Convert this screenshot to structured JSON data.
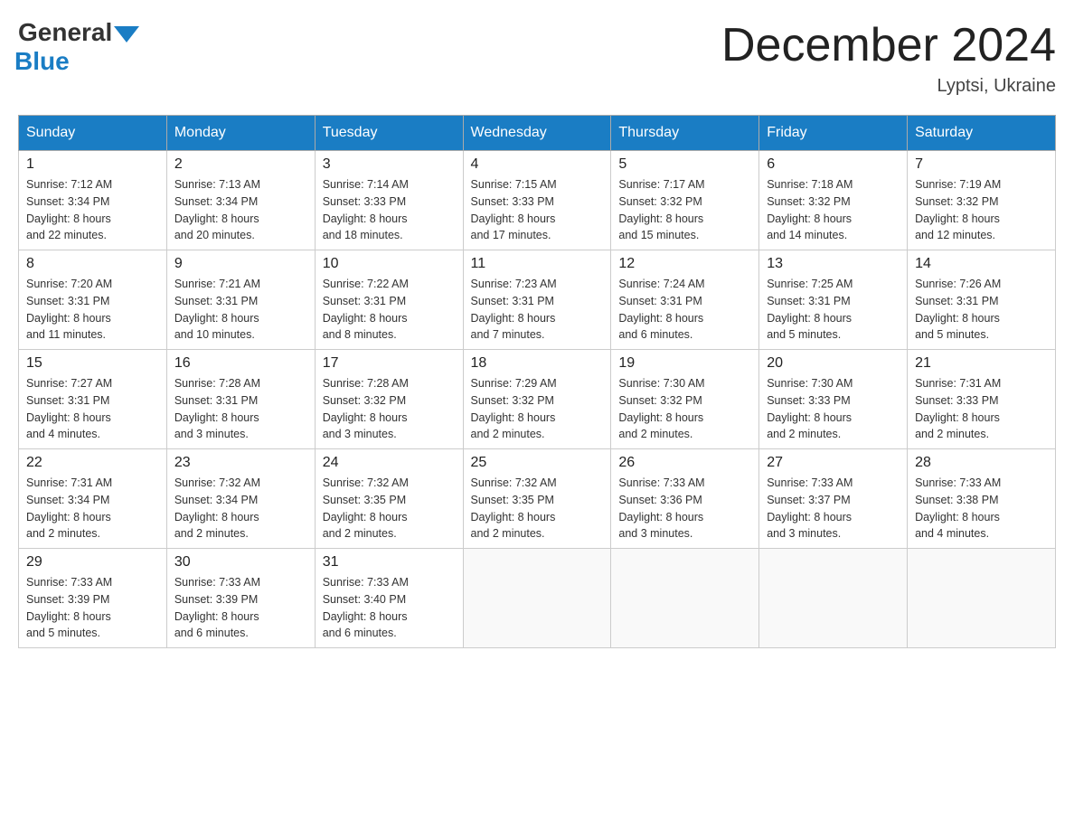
{
  "logo": {
    "general": "General",
    "blue": "Blue"
  },
  "header": {
    "month": "December 2024",
    "location": "Lyptsi, Ukraine"
  },
  "weekdays": [
    "Sunday",
    "Monday",
    "Tuesday",
    "Wednesday",
    "Thursday",
    "Friday",
    "Saturday"
  ],
  "weeks": [
    [
      {
        "day": "1",
        "sunrise": "7:12 AM",
        "sunset": "3:34 PM",
        "daylight": "8 hours and 22 minutes."
      },
      {
        "day": "2",
        "sunrise": "7:13 AM",
        "sunset": "3:34 PM",
        "daylight": "8 hours and 20 minutes."
      },
      {
        "day": "3",
        "sunrise": "7:14 AM",
        "sunset": "3:33 PM",
        "daylight": "8 hours and 18 minutes."
      },
      {
        "day": "4",
        "sunrise": "7:15 AM",
        "sunset": "3:33 PM",
        "daylight": "8 hours and 17 minutes."
      },
      {
        "day": "5",
        "sunrise": "7:17 AM",
        "sunset": "3:32 PM",
        "daylight": "8 hours and 15 minutes."
      },
      {
        "day": "6",
        "sunrise": "7:18 AM",
        "sunset": "3:32 PM",
        "daylight": "8 hours and 14 minutes."
      },
      {
        "day": "7",
        "sunrise": "7:19 AM",
        "sunset": "3:32 PM",
        "daylight": "8 hours and 12 minutes."
      }
    ],
    [
      {
        "day": "8",
        "sunrise": "7:20 AM",
        "sunset": "3:31 PM",
        "daylight": "8 hours and 11 minutes."
      },
      {
        "day": "9",
        "sunrise": "7:21 AM",
        "sunset": "3:31 PM",
        "daylight": "8 hours and 10 minutes."
      },
      {
        "day": "10",
        "sunrise": "7:22 AM",
        "sunset": "3:31 PM",
        "daylight": "8 hours and 8 minutes."
      },
      {
        "day": "11",
        "sunrise": "7:23 AM",
        "sunset": "3:31 PM",
        "daylight": "8 hours and 7 minutes."
      },
      {
        "day": "12",
        "sunrise": "7:24 AM",
        "sunset": "3:31 PM",
        "daylight": "8 hours and 6 minutes."
      },
      {
        "day": "13",
        "sunrise": "7:25 AM",
        "sunset": "3:31 PM",
        "daylight": "8 hours and 5 minutes."
      },
      {
        "day": "14",
        "sunrise": "7:26 AM",
        "sunset": "3:31 PM",
        "daylight": "8 hours and 5 minutes."
      }
    ],
    [
      {
        "day": "15",
        "sunrise": "7:27 AM",
        "sunset": "3:31 PM",
        "daylight": "8 hours and 4 minutes."
      },
      {
        "day": "16",
        "sunrise": "7:28 AM",
        "sunset": "3:31 PM",
        "daylight": "8 hours and 3 minutes."
      },
      {
        "day": "17",
        "sunrise": "7:28 AM",
        "sunset": "3:32 PM",
        "daylight": "8 hours and 3 minutes."
      },
      {
        "day": "18",
        "sunrise": "7:29 AM",
        "sunset": "3:32 PM",
        "daylight": "8 hours and 2 minutes."
      },
      {
        "day": "19",
        "sunrise": "7:30 AM",
        "sunset": "3:32 PM",
        "daylight": "8 hours and 2 minutes."
      },
      {
        "day": "20",
        "sunrise": "7:30 AM",
        "sunset": "3:33 PM",
        "daylight": "8 hours and 2 minutes."
      },
      {
        "day": "21",
        "sunrise": "7:31 AM",
        "sunset": "3:33 PM",
        "daylight": "8 hours and 2 minutes."
      }
    ],
    [
      {
        "day": "22",
        "sunrise": "7:31 AM",
        "sunset": "3:34 PM",
        "daylight": "8 hours and 2 minutes."
      },
      {
        "day": "23",
        "sunrise": "7:32 AM",
        "sunset": "3:34 PM",
        "daylight": "8 hours and 2 minutes."
      },
      {
        "day": "24",
        "sunrise": "7:32 AM",
        "sunset": "3:35 PM",
        "daylight": "8 hours and 2 minutes."
      },
      {
        "day": "25",
        "sunrise": "7:32 AM",
        "sunset": "3:35 PM",
        "daylight": "8 hours and 2 minutes."
      },
      {
        "day": "26",
        "sunrise": "7:33 AM",
        "sunset": "3:36 PM",
        "daylight": "8 hours and 3 minutes."
      },
      {
        "day": "27",
        "sunrise": "7:33 AM",
        "sunset": "3:37 PM",
        "daylight": "8 hours and 3 minutes."
      },
      {
        "day": "28",
        "sunrise": "7:33 AM",
        "sunset": "3:38 PM",
        "daylight": "8 hours and 4 minutes."
      }
    ],
    [
      {
        "day": "29",
        "sunrise": "7:33 AM",
        "sunset": "3:39 PM",
        "daylight": "8 hours and 5 minutes."
      },
      {
        "day": "30",
        "sunrise": "7:33 AM",
        "sunset": "3:39 PM",
        "daylight": "8 hours and 6 minutes."
      },
      {
        "day": "31",
        "sunrise": "7:33 AM",
        "sunset": "3:40 PM",
        "daylight": "8 hours and 6 minutes."
      },
      null,
      null,
      null,
      null
    ]
  ],
  "labels": {
    "sunrise": "Sunrise:",
    "sunset": "Sunset:",
    "daylight": "Daylight:"
  }
}
